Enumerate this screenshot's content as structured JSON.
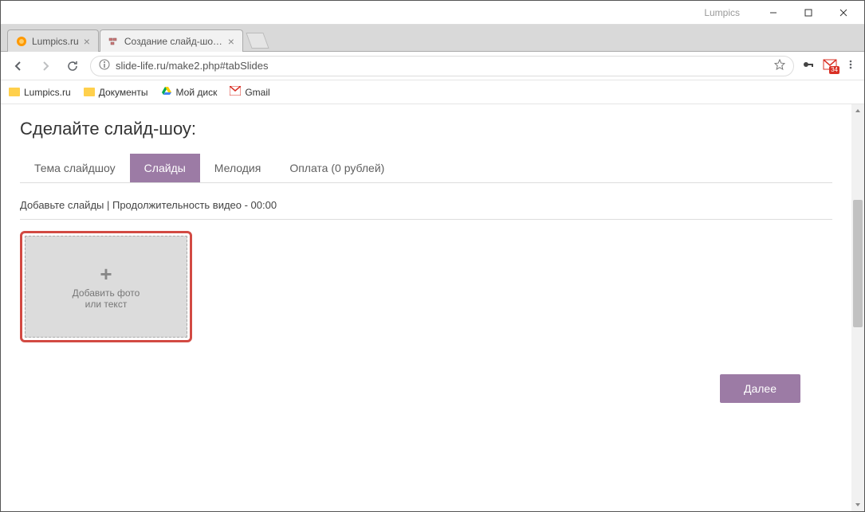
{
  "window": {
    "app_name": "Lumpics"
  },
  "browser": {
    "tabs": [
      {
        "title": "Lumpics.ru",
        "active": false
      },
      {
        "title": "Создание слайд-шоу —",
        "active": true
      }
    ],
    "url_display": "slide-life.ru/make2.php#tabSlides",
    "bookmarks": [
      {
        "label": "Lumpics.ru",
        "kind": "folder"
      },
      {
        "label": "Документы",
        "kind": "folder"
      },
      {
        "label": "Мой диск",
        "kind": "drive"
      },
      {
        "label": "Gmail",
        "kind": "gmail"
      }
    ],
    "gmail_badge": "34"
  },
  "page": {
    "title": "Сделайте слайд-шоу:",
    "tabs": [
      {
        "label": "Тема слайдшоу",
        "active": false
      },
      {
        "label": "Слайды",
        "active": true
      },
      {
        "label": "Мелодия",
        "active": false
      },
      {
        "label": "Оплата (0 рублей)",
        "active": false
      }
    ],
    "instructions": "Добавьте слайды | Продолжительность видео - 00:00",
    "add_slide": {
      "line1": "Добавить фото",
      "line2": "или текст"
    },
    "next_button": "Далее"
  }
}
